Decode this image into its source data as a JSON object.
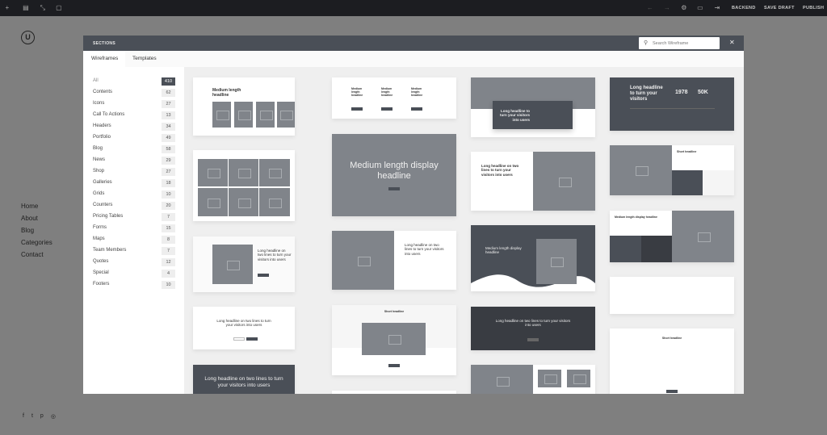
{
  "topbar": {
    "icons": [
      "plus-icon",
      "layout-icon",
      "resize-icon",
      "page-icon",
      "undo-icon",
      "redo-icon",
      "gear-icon",
      "monitor-icon",
      "exit-icon"
    ],
    "backend": "BACKEND",
    "save_draft": "SAVE DRAFT",
    "publish": "PUBLISH"
  },
  "site": {
    "logo": "U",
    "nav": [
      "Home",
      "About",
      "Blog",
      "Categories",
      "Contact"
    ],
    "social": [
      "f",
      "t",
      "p",
      "◎"
    ]
  },
  "modal": {
    "title": "SECTIONS",
    "search_placeholder": "Search Wireframe",
    "close": "✕",
    "tabs": [
      "Wireframes",
      "Templates"
    ],
    "categories": [
      {
        "label": "All",
        "count": "410"
      },
      {
        "label": "Contents",
        "count": "62"
      },
      {
        "label": "Icons",
        "count": "27"
      },
      {
        "label": "Call To Actions",
        "count": "13"
      },
      {
        "label": "Headers",
        "count": "34"
      },
      {
        "label": "Portfolio",
        "count": "49"
      },
      {
        "label": "Blog",
        "count": "58"
      },
      {
        "label": "News",
        "count": "29"
      },
      {
        "label": "Shop",
        "count": "27"
      },
      {
        "label": "Galleries",
        "count": "18"
      },
      {
        "label": "Grids",
        "count": "10"
      },
      {
        "label": "Counters",
        "count": "20"
      },
      {
        "label": "Pricing Tables",
        "count": "7"
      },
      {
        "label": "Forms",
        "count": "15"
      },
      {
        "label": "Maps",
        "count": "8"
      },
      {
        "label": "Team Members",
        "count": "7"
      },
      {
        "label": "Quotes",
        "count": "12"
      },
      {
        "label": "Special",
        "count": "4"
      },
      {
        "label": "Footers",
        "count": "10"
      }
    ]
  },
  "cards": {
    "medium_headline": "Medium length headline",
    "display_headline": "Medium length display headline",
    "long_two_lines": "Long headline on two lines to turn your visitors into users",
    "long_turn": "Long headline to turn your visitors into users",
    "long_visitors": "Long headline to turn your visitors",
    "stat1": "1978",
    "stat2": "50K",
    "short_headline": "Short headline",
    "medium_display": "Medium length display headline"
  }
}
